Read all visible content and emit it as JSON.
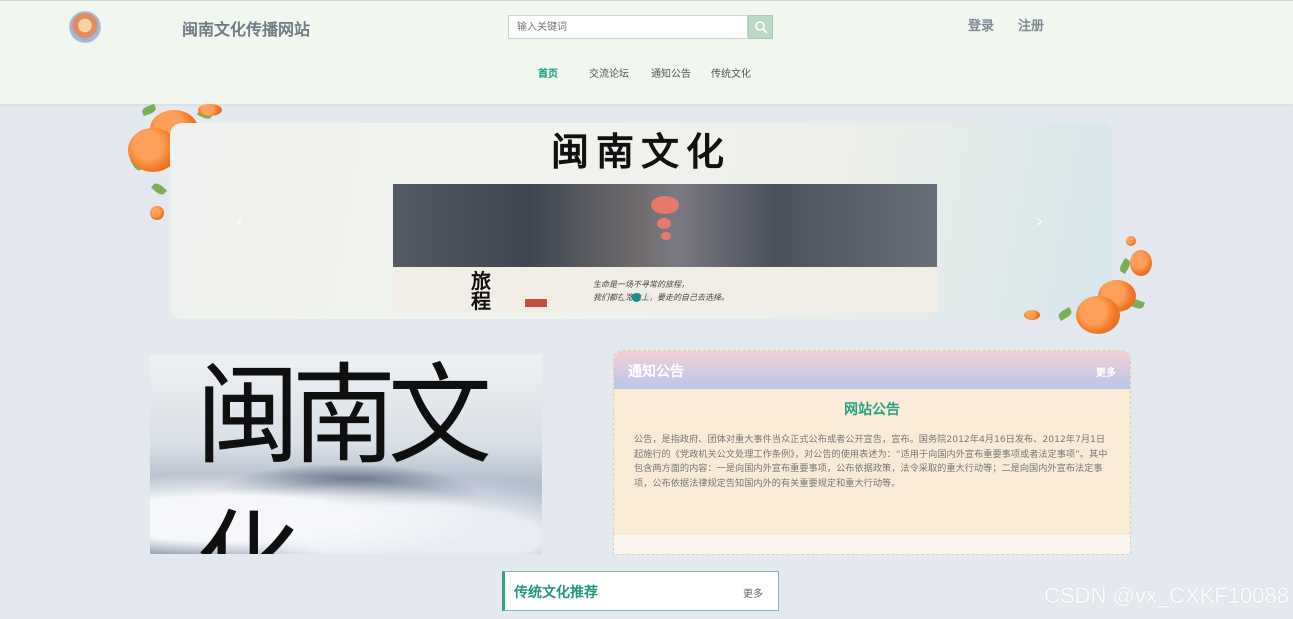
{
  "header": {
    "site_title": "闽南文化传播网站",
    "logo_icon": "temple-logo-icon",
    "search": {
      "placeholder": "输入关键词"
    },
    "auth": {
      "login": "登录",
      "register": "注册"
    },
    "nav": [
      {
        "label": "首页",
        "active": true
      },
      {
        "label": "交流论坛",
        "active": false
      },
      {
        "label": "通知公告",
        "active": false
      },
      {
        "label": "传统文化",
        "active": false
      }
    ]
  },
  "banner": {
    "title": "闽南文化",
    "photo_caption_left": "旅\n程",
    "photo_caption_lines": [
      "生命是一场不寻常的旅程，",
      "我们都在路途上，要走的自己去选择。"
    ],
    "slides": 3,
    "active_slide": 1,
    "prev_icon": "chevron-left-icon",
    "next_icon": "chevron-right-icon"
  },
  "culture_image": {
    "text": "闽南文化"
  },
  "notice": {
    "title": "通知公告",
    "more": "更多",
    "subtitle": "网站公告",
    "body": "公告，是指政府、团体对重大事件当众正式公布或者公开宣告，宣布。国务院2012年4月16日发布、2012年7月1日起施行的《党政机关公文处理工作条例》，对公告的使用表述为：“适用于向国内外宣布重要事项或者法定事项”。其中包含两方面的内容：一是向国内外宣布重要事项，公布依据政策，法令采取的重大行动等；二是向国内外宣布法定事项，公布依据法律规定告知国内外的有关重要规定和重大行动等。"
  },
  "recommend": {
    "title": "传统文化推荐",
    "more": "更多"
  },
  "watermark": "CSDN @vx_CXKF10088",
  "colors": {
    "accent": "#1a9a87",
    "header_bg": "#f1f6ef",
    "page_bg": "#e3e9ee",
    "notice_bg": "#faebd6"
  }
}
